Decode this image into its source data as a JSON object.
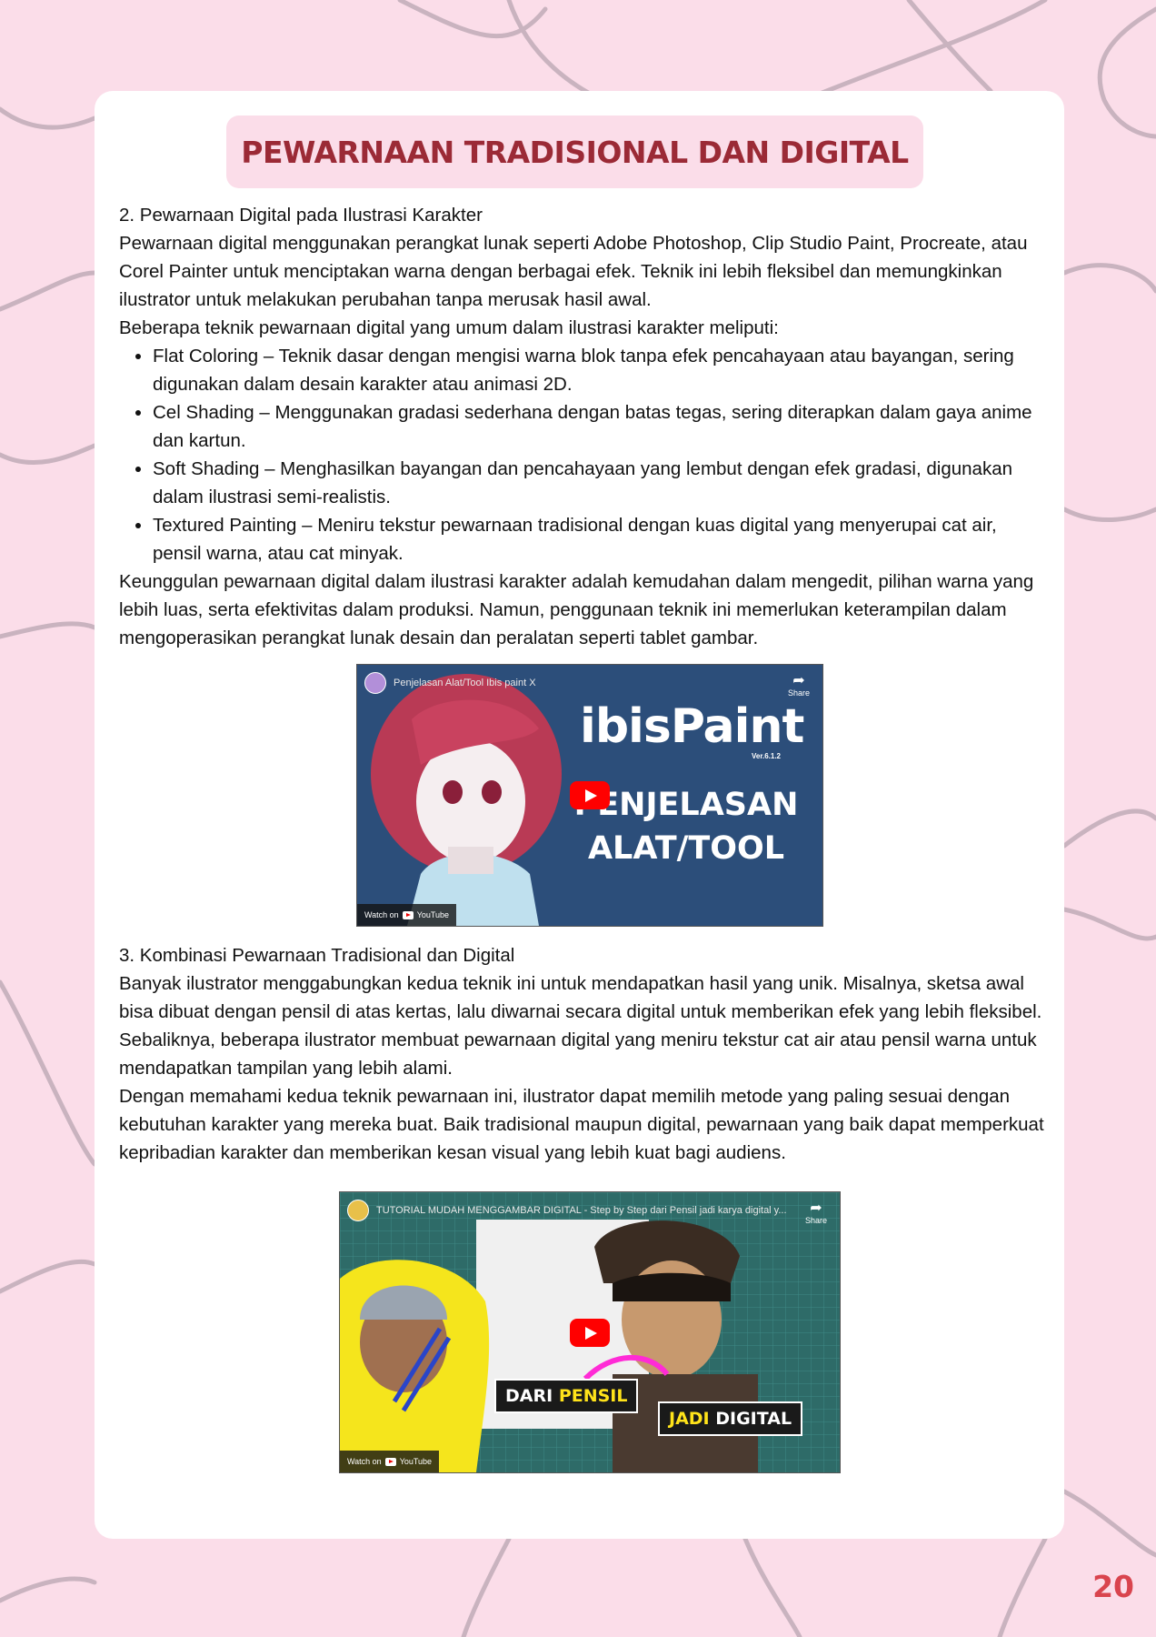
{
  "title": "PEWARNAAN TRADISIONAL DAN DIGITAL",
  "section2": {
    "heading": "2. Pewarnaan Digital pada Ilustrasi Karakter",
    "intro": "Pewarnaan digital menggunakan perangkat lunak seperti Adobe Photoshop, Clip Studio Paint, Procreate, atau Corel Painter untuk menciptakan warna dengan berbagai efek. Teknik ini lebih fleksibel dan memungkinkan ilustrator untuk melakukan perubahan tanpa merusak hasil awal.",
    "lead": "Beberapa teknik pewarnaan digital yang umum dalam ilustrasi karakter meliputi:",
    "bullets": [
      "Flat Coloring – Teknik dasar dengan mengisi warna blok tanpa efek pencahayaan atau bayangan, sering digunakan dalam desain karakter atau animasi 2D.",
      "Cel Shading – Menggunakan gradasi sederhana dengan batas tegas, sering diterapkan dalam gaya anime dan kartun.",
      "Soft Shading – Menghasilkan bayangan dan pencahayaan yang lembut dengan efek gradasi, digunakan dalam ilustrasi semi-realistis.",
      "Textured Painting – Meniru tekstur pewarnaan tradisional dengan kuas digital yang menyerupai cat air, pensil warna, atau cat minyak."
    ],
    "closing": "Keunggulan pewarnaan digital dalam ilustrasi karakter adalah kemudahan dalam mengedit, pilihan warna yang lebih luas, serta efektivitas dalam produksi. Namun, penggunaan teknik ini memerlukan keterampilan dalam mengoperasikan perangkat lunak desain dan peralatan seperti tablet gambar."
  },
  "video1": {
    "title": "Penjelasan Alat/Tool Ibis paint X",
    "share": "Share",
    "brand": "ibisPaint",
    "version": "Ver.6.1.2",
    "line1": "PENJELASAN",
    "line2": "ALAT/TOOL",
    "watch": "Watch on",
    "yt": "YouTube"
  },
  "section3": {
    "heading": "3. Kombinasi Pewarnaan Tradisional dan Digital",
    "para1": "Banyak ilustrator menggabungkan kedua teknik ini untuk mendapatkan hasil yang unik. Misalnya, sketsa awal bisa dibuat dengan pensil di atas kertas, lalu diwarnai secara digital untuk memberikan efek yang lebih fleksibel. Sebaliknya, beberapa ilustrator membuat pewarnaan digital yang meniru tekstur cat air atau pensil warna untuk mendapatkan tampilan yang lebih alami.",
    "para2": "Dengan memahami kedua teknik pewarnaan ini, ilustrator dapat memilih metode yang paling sesuai dengan kebutuhan karakter yang mereka buat. Baik tradisional maupun digital, pewarnaan yang baik dapat memperkuat kepribadian karakter dan memberikan kesan visual yang lebih kuat bagi audiens."
  },
  "video2": {
    "title": "TUTORIAL MUDAH MENGGAMBAR DIGITAL - Step by Step dari Pensil jadi karya digital y...",
    "share": "Share",
    "tag1a": "DARI",
    "tag1b": "PENSIL",
    "tag2a": "JADI",
    "tag2b": "DIGITAL",
    "watch": "Watch on",
    "yt": "YouTube"
  },
  "page_number": "20"
}
